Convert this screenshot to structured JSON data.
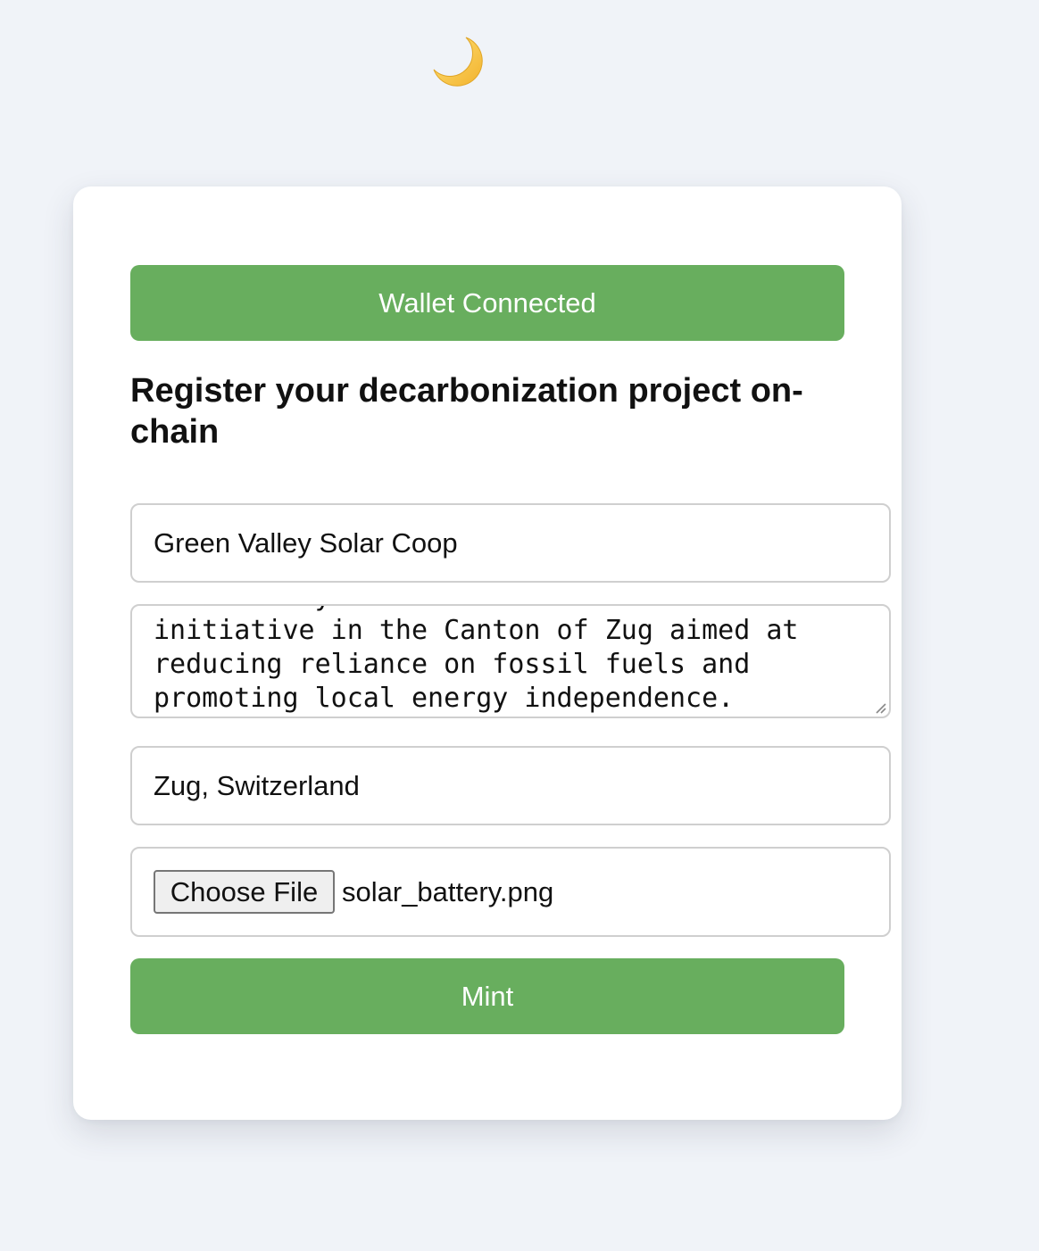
{
  "theme_toggle": {
    "icon": "crescent-moon-icon",
    "color": "#f4c542"
  },
  "wallet": {
    "label": "Wallet Connected"
  },
  "form": {
    "title": "Register your decarbonization project on-chain",
    "project_name": "Green Valley Solar Coop",
    "description": "A community-led solar installation\ninitiative in the Canton of Zug aimed at\nreducing reliance on fossil fuels and\npromoting local energy independence.",
    "location": "Zug, Switzerland",
    "file_button": "Choose File",
    "file_name": "solar_battery.png",
    "submit_label": "Mint"
  },
  "colors": {
    "accent": "#68ae5e",
    "background": "#f0f3f8",
    "card": "#ffffff"
  }
}
